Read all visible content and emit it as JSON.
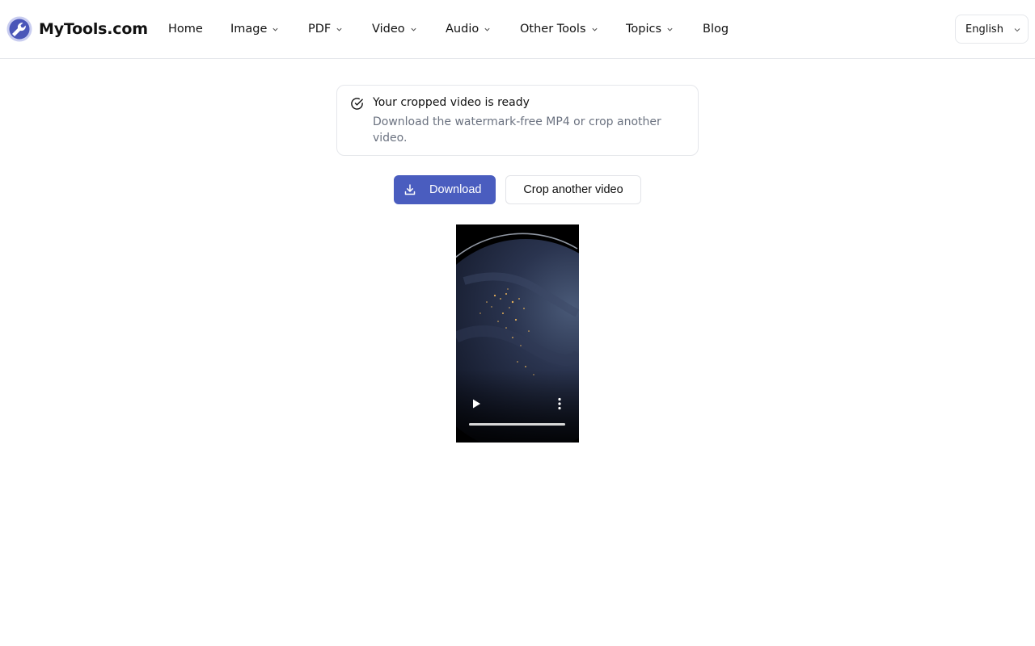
{
  "brand": {
    "name": "MyTools.com"
  },
  "nav": {
    "home": "Home",
    "image": "Image",
    "pdf": "PDF",
    "video": "Video",
    "audio": "Audio",
    "other_tools": "Other Tools",
    "topics": "Topics",
    "blog": "Blog"
  },
  "language": {
    "selected": "English"
  },
  "notice": {
    "title": "Your cropped video is ready",
    "description": "Download the watermark-free MP4 or crop another video."
  },
  "actions": {
    "download_label": "Download",
    "crop_another_label": "Crop another video"
  },
  "video_player": {
    "progress": 1.0,
    "icons": {
      "play": "play-icon",
      "more": "more-vertical-icon"
    }
  },
  "colors": {
    "accent": "#4a5dbf",
    "border": "#e5e7eb",
    "muted_text": "#6b7280",
    "logo": "#4a56b8"
  }
}
